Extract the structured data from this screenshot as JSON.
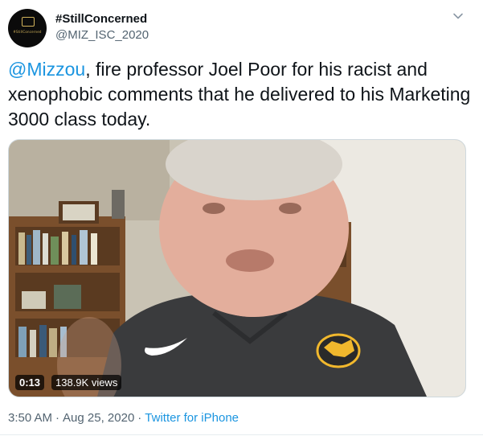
{
  "author": {
    "display_name": "#StillConcerned",
    "handle": "@MIZ_ISC_2020",
    "avatar_text": "#StillConcerned"
  },
  "menu": {
    "icon": "chevron-down-icon"
  },
  "tweet": {
    "mention": "@Mizzou",
    "text_rest": ", fire professor Joel Poor for his racist and xenophobic comments that he delivered to his Marketing 3000 class today."
  },
  "video": {
    "duration": "0:13",
    "views": "138.9K views"
  },
  "meta": {
    "time": "3:50 AM",
    "separator": "·",
    "date": "Aug 25, 2020",
    "source": "Twitter for iPhone"
  },
  "colors": {
    "link": "#1b95e0",
    "secondary_text": "#536471",
    "primary_text": "#0f1419"
  }
}
